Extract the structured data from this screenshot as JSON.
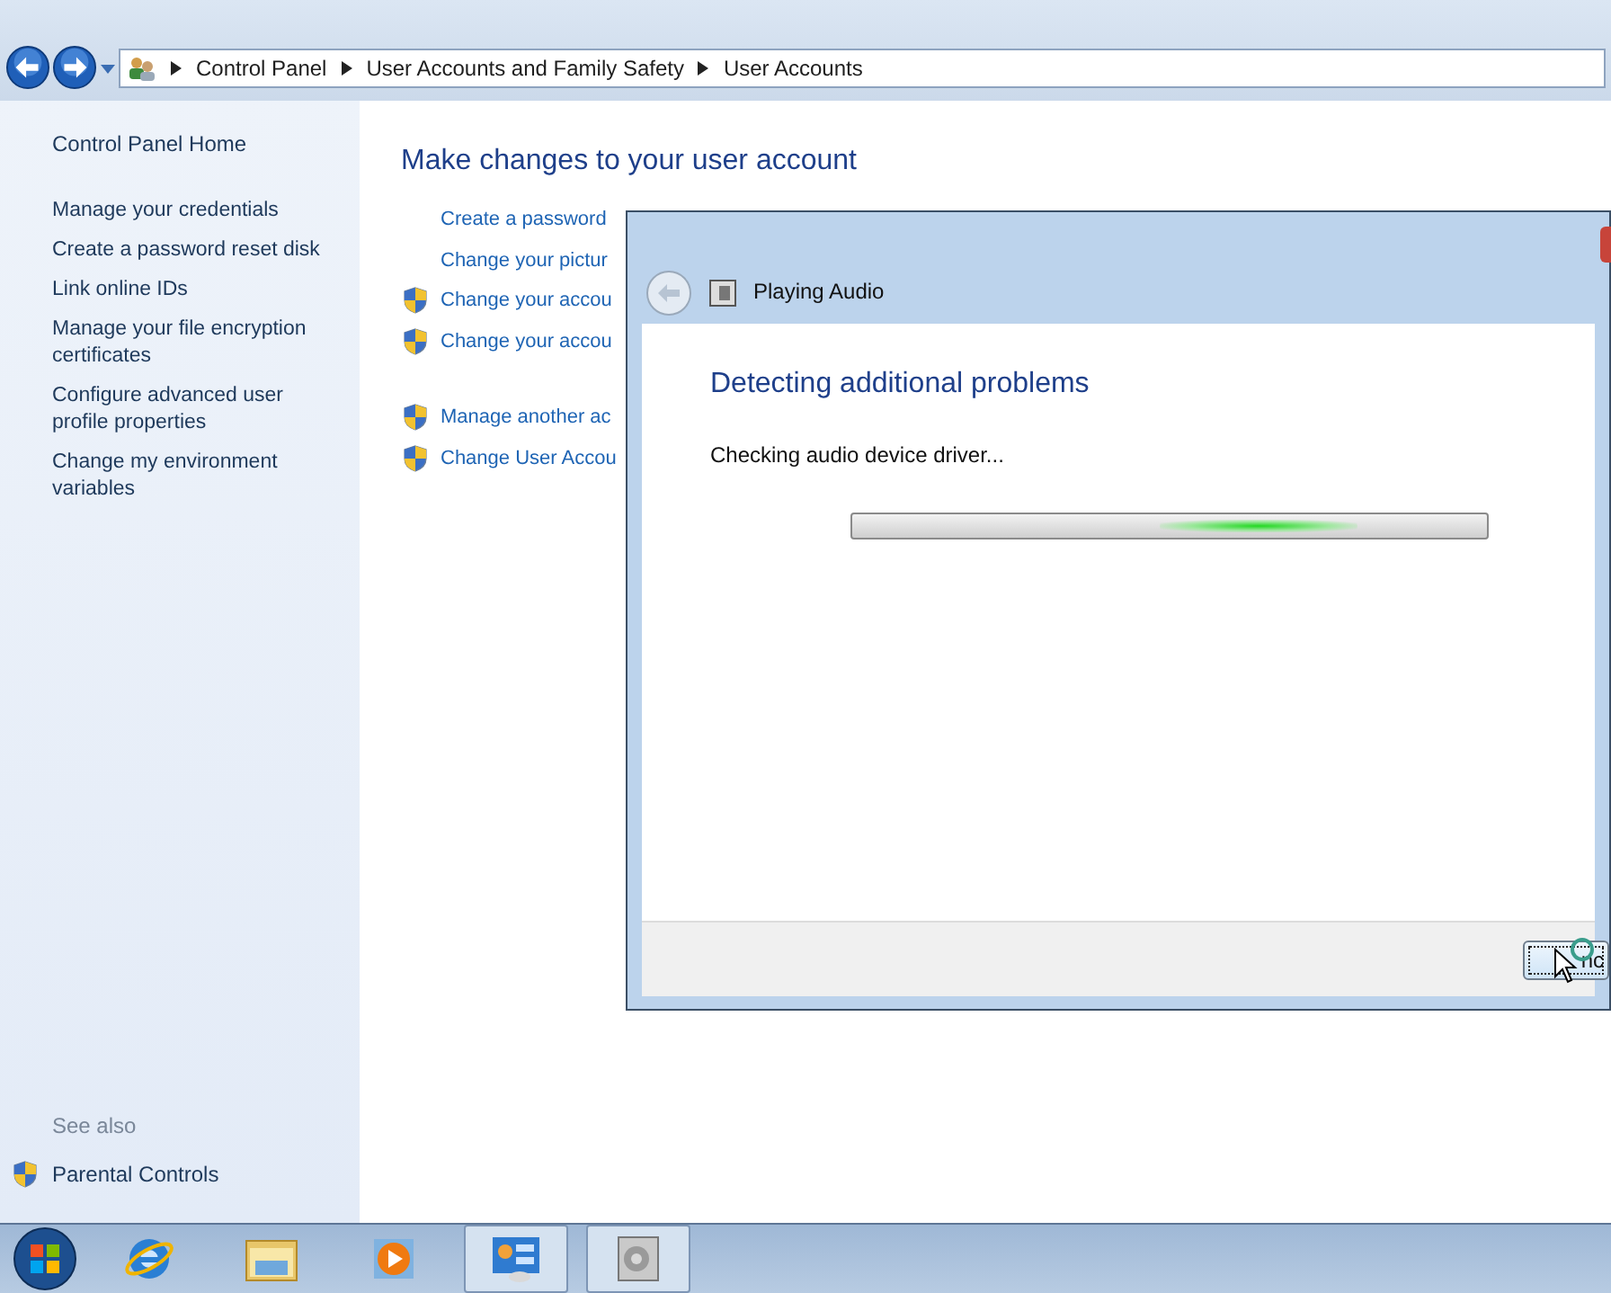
{
  "address_bar": {
    "crumbs": [
      "Control Panel",
      "User Accounts and Family Safety",
      "User Accounts"
    ]
  },
  "sidebar": {
    "home": "Control Panel Home",
    "items": [
      "Manage your credentials",
      "Create a password reset disk",
      "Link online IDs",
      "Manage your file encryption certificates",
      "Configure advanced user profile properties",
      "Change my environment variables"
    ],
    "see_also_title": "See also",
    "see_also": [
      {
        "label": "Parental Controls",
        "shield": true
      }
    ]
  },
  "main": {
    "heading": "Make changes to your user account",
    "groups": [
      [
        {
          "label": "Create a password",
          "shield": false
        },
        {
          "label": "Change your pictur",
          "shield": false
        },
        {
          "label": "Change your accou",
          "shield": true
        },
        {
          "label": "Change your accou",
          "shield": true
        }
      ],
      [
        {
          "label": "Manage another ac",
          "shield": true
        },
        {
          "label": "Change User Accou",
          "shield": true
        }
      ]
    ]
  },
  "dialog": {
    "title": "Playing Audio",
    "heading": "Detecting additional problems",
    "status": "Checking audio device driver...",
    "button": "nc",
    "progress": {
      "level": 0.64
    }
  },
  "taskbar": {
    "items": [
      {
        "kind": "ie",
        "open": false
      },
      {
        "kind": "explorer",
        "open": false
      },
      {
        "kind": "media",
        "open": false
      },
      {
        "kind": "control-panel",
        "open": true
      },
      {
        "kind": "troubleshooter",
        "open": true
      }
    ]
  }
}
